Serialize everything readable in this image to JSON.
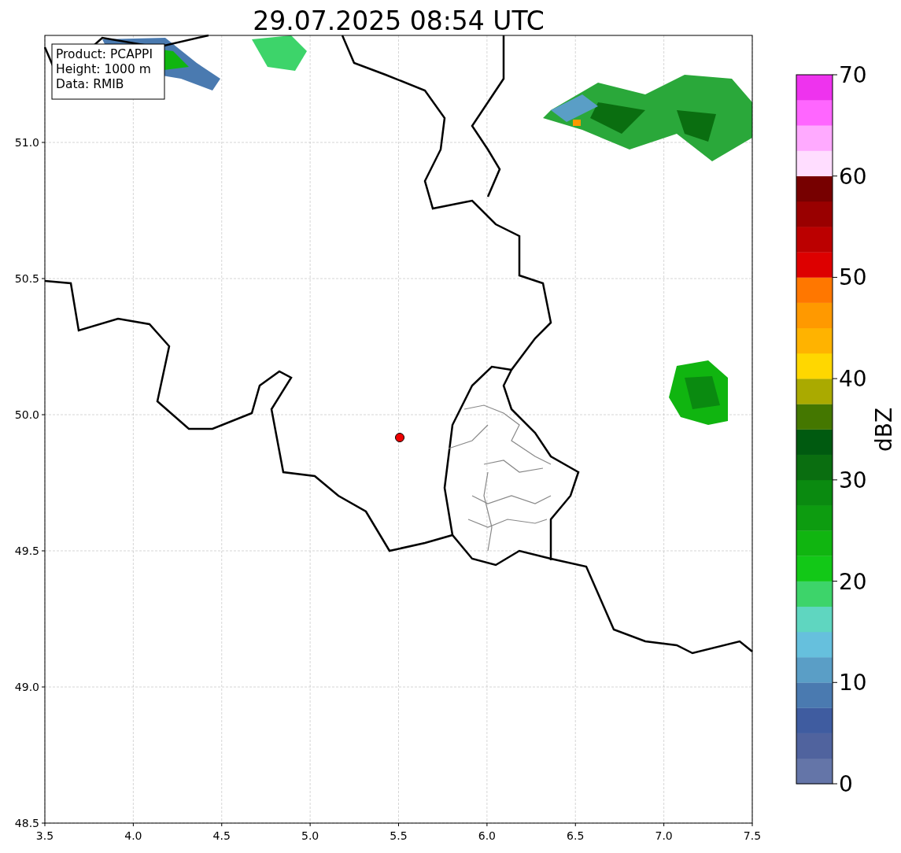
{
  "title": "29.07.2025 08:54 UTC",
  "info_box": [
    "Product: PCAPPI",
    "Height: 1000 m",
    "Data: RMIB"
  ],
  "x_ticks": [
    "3.5",
    "4.0",
    "4.5",
    "5.0",
    "5.5",
    "6.0",
    "6.5",
    "7.0",
    "7.5"
  ],
  "y_ticks": [
    "51.0",
    "50.5",
    "50.0",
    "49.5",
    "49.0",
    "48.5"
  ],
  "colorbar": {
    "label": "dBZ",
    "ticks": [
      "70",
      "60",
      "50",
      "40",
      "30",
      "20",
      "10",
      "0"
    ],
    "bins": [
      {
        "color": "#6475a8"
      },
      {
        "color": "#50639e"
      },
      {
        "color": "#3f5ca0"
      },
      {
        "color": "#4a7ab0"
      },
      {
        "color": "#5a9ec6"
      },
      {
        "color": "#66c0dd"
      },
      {
        "color": "#5fd6c0"
      },
      {
        "color": "#3dd46a"
      },
      {
        "color": "#12c817"
      },
      {
        "color": "#10b510"
      },
      {
        "color": "#0d9c10"
      },
      {
        "color": "#0a8a10"
      },
      {
        "color": "#0a6e10"
      },
      {
        "color": "#005a10"
      },
      {
        "color": "#447700"
      },
      {
        "color": "#aaaa00"
      },
      {
        "color": "#ffd700"
      },
      {
        "color": "#ffb300"
      },
      {
        "color": "#ff9900"
      },
      {
        "color": "#ff7700"
      },
      {
        "color": "#dd0000"
      },
      {
        "color": "#bb0000"
      },
      {
        "color": "#990000"
      },
      {
        "color": "#770000"
      },
      {
        "color": "#ffddff"
      },
      {
        "color": "#ffaaff"
      },
      {
        "color": "#ff66ff"
      },
      {
        "color": "#ee33ee"
      }
    ]
  }
}
